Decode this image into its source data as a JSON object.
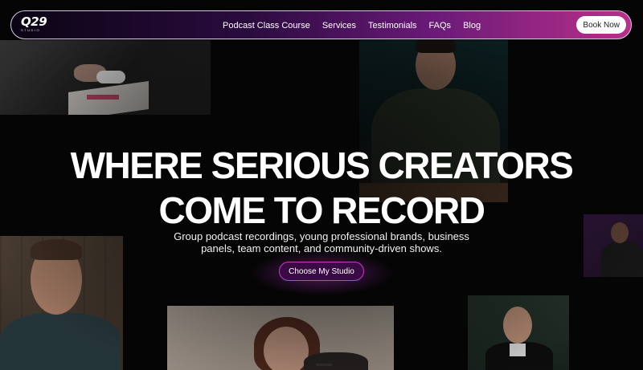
{
  "navbar": {
    "logo_mark": "Q29",
    "logo_sub": "STUDIO",
    "links": [
      "Podcast Class Course",
      "Services",
      "Testimonials",
      "FAQs",
      "Blog"
    ],
    "book_label": "Book Now"
  },
  "hero": {
    "title_line1": "WHERE SERIOUS CREATORS",
    "title_line2": "COME TO RECORD",
    "subtitle": "Group podcast recordings, young professional brands, business panels, team content, and community-driven shows.",
    "cta_label": "Choose My Studio"
  },
  "colors": {
    "nav_gradient_start": "#0b0414",
    "nav_gradient_end": "#b8308a",
    "cta_border": "#c03fc4",
    "background": "#050505"
  }
}
